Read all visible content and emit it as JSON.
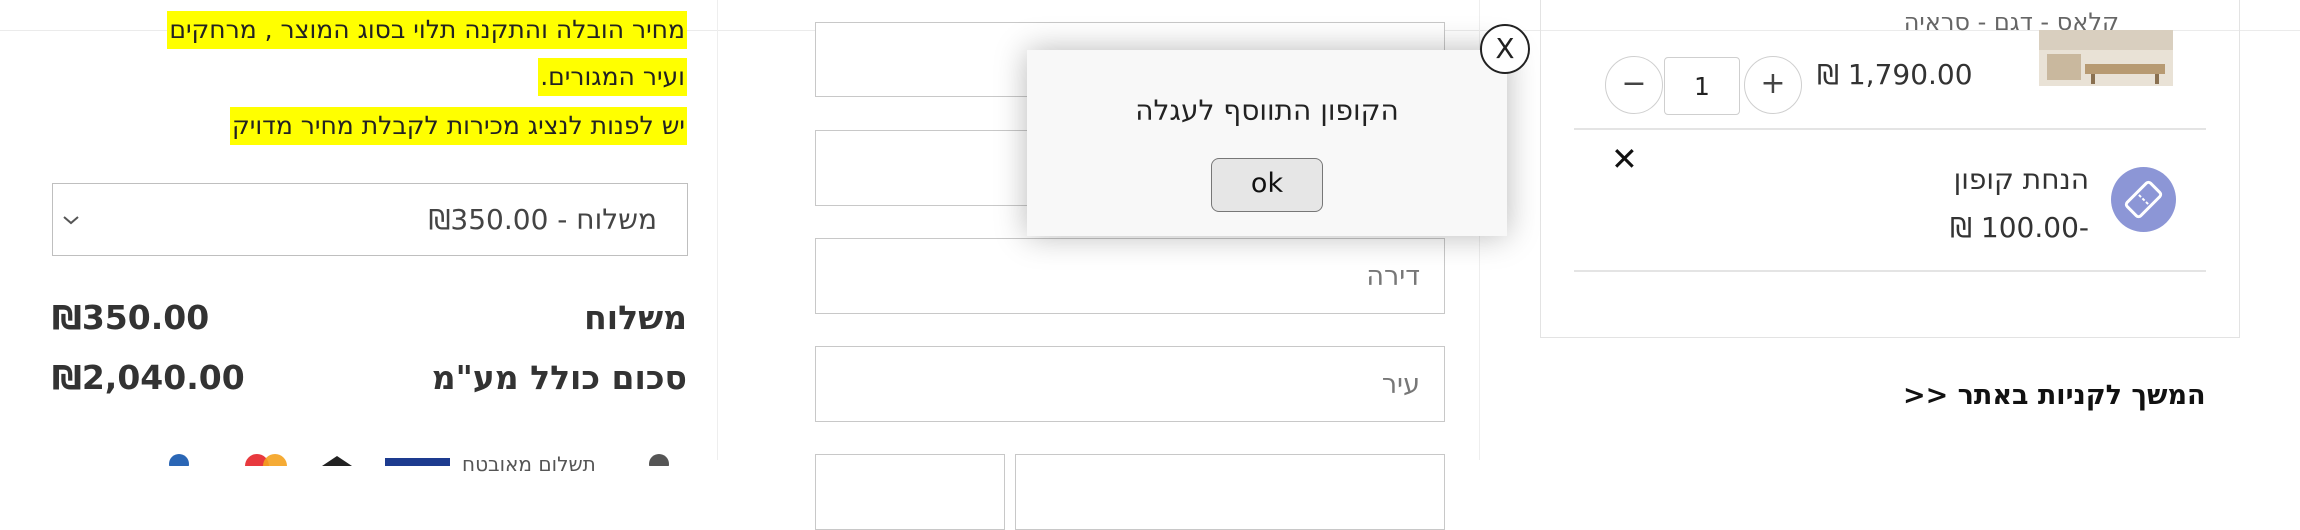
{
  "summary": {
    "notice_lines": [
      "מחיר הובלה והתקנה תלוי בסוג המוצר , מרחקים",
      "ועיר המגורים.",
      "יש לפנות לנציג מכירות לקבלת מחיר מדויק"
    ],
    "shipping_select_value": "משלוח - ₪350.00",
    "shipping_label": "משלוח",
    "shipping_value": "₪350.00",
    "total_label": "סכום כולל מע\"מ",
    "total_value": "₪2,040.00",
    "payment_label": "תשלום מאובטח"
  },
  "form": {
    "apartment_placeholder": "דירה",
    "city_placeholder": "עיר"
  },
  "cart": {
    "product_name": "קלאס - דגם - סראיה",
    "quantity": "1",
    "minus_label": "−",
    "plus_label": "+",
    "price": "₪ 1,790.00",
    "coupon_discount_text": "הנחת קופון -100.00 ₪",
    "remove_symbol": "✕",
    "continue_shopping": "המשך לקניות באתר <<"
  },
  "dialog": {
    "message": "הקופון התווסף לעגלה",
    "ok_label": "ok",
    "close_label": "X"
  },
  "colors": {
    "highlight": "#ffff00",
    "coupon_icon": "#8c96d6"
  },
  "icons": {
    "dropdown": "chevron-down-icon",
    "coupon": "coupon-ticket-icon",
    "remove": "close-icon"
  }
}
